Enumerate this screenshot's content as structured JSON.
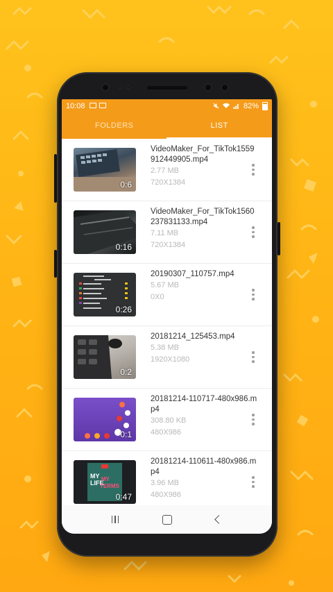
{
  "statusbar": {
    "time": "10:08",
    "battery": "82%"
  },
  "tabs": [
    {
      "label": "FOLDERS",
      "active": false
    },
    {
      "label": "LIST",
      "active": true
    }
  ],
  "videos": [
    {
      "name": "VideoMaker_For_TikTok1559912449905.mp4",
      "size": "2.77 MB",
      "resolution": "720X1384",
      "duration": "0:6"
    },
    {
      "name": "VideoMaker_For_TikTok1560237831133.mp4",
      "size": "7.11 MB",
      "resolution": "720X1384",
      "duration": "0:16"
    },
    {
      "name": "20190307_110757.mp4",
      "size": "5.67 MB",
      "resolution": "0X0",
      "duration": "0:26"
    },
    {
      "name": "20181214_125453.mp4",
      "size": "5.38 MB",
      "resolution": "1920X1080",
      "duration": "0:2"
    },
    {
      "name": "20181214-110717-480x986.mp4",
      "size": "308.80 KB",
      "resolution": "480X986",
      "duration": "0:1"
    },
    {
      "name": "20181214-110611-480x986.mp4",
      "size": "3.96 MB",
      "resolution": "480X986",
      "duration": "0:47"
    }
  ],
  "colors": {
    "accent": "#f59b1a",
    "background": "#ffb515"
  },
  "icons": {
    "more": "more-vertical-icon",
    "recent": "recent-apps-icon",
    "home": "home-icon",
    "back": "back-icon"
  }
}
